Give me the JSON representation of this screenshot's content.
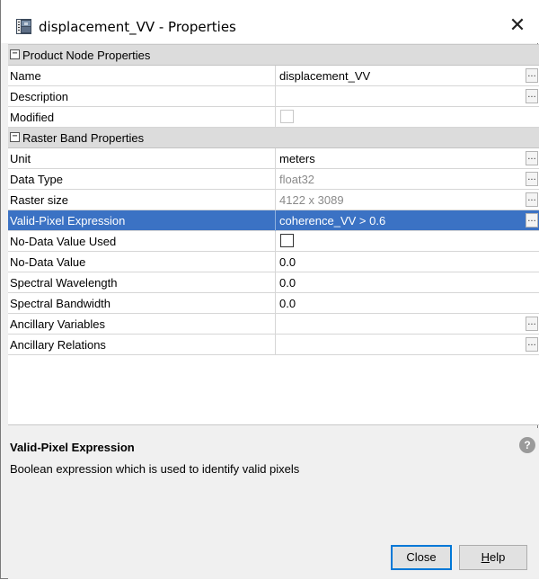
{
  "window": {
    "title": "displacement_VV - Properties",
    "close_symbol": "✕"
  },
  "sections": {
    "product": {
      "label": "Product Node Properties",
      "toggle": "−",
      "rows": {
        "name": {
          "key": "Name",
          "value": "displacement_VV"
        },
        "description": {
          "key": "Description",
          "value": ""
        },
        "modified": {
          "key": "Modified",
          "checked": false,
          "enabled": false
        }
      }
    },
    "raster": {
      "label": "Raster Band Properties",
      "toggle": "−",
      "rows": {
        "unit": {
          "key": "Unit",
          "value": "meters"
        },
        "data_type": {
          "key": "Data Type",
          "value": "float32"
        },
        "raster_size": {
          "key": "Raster size",
          "value": "4122 x 3089"
        },
        "valid_pixel": {
          "key": "Valid-Pixel Expression",
          "value": "coherence_VV > 0.6"
        },
        "no_data_used": {
          "key": "No-Data Value Used",
          "checked": false,
          "enabled": true
        },
        "no_data_value": {
          "key": "No-Data Value",
          "value": "0.0"
        },
        "spectral_wavelength": {
          "key": "Spectral Wavelength",
          "value": "0.0"
        },
        "spectral_bandwidth": {
          "key": "Spectral Bandwidth",
          "value": "0.0"
        },
        "ancillary_variables": {
          "key": "Ancillary Variables",
          "value": ""
        },
        "ancillary_relations": {
          "key": "Ancillary Relations",
          "value": ""
        }
      }
    }
  },
  "ellipsis": "...",
  "help_panel": {
    "title": "Valid-Pixel Expression",
    "description": "Boolean expression which is used to identify valid pixels",
    "help_symbol": "?"
  },
  "buttons": {
    "close": "Close",
    "help_mnemonic": "H",
    "help_rest": "elp"
  },
  "colors": {
    "selection": "#3b72c4",
    "section_bg": "#dcdcdc",
    "focus_border": "#0078d7"
  }
}
